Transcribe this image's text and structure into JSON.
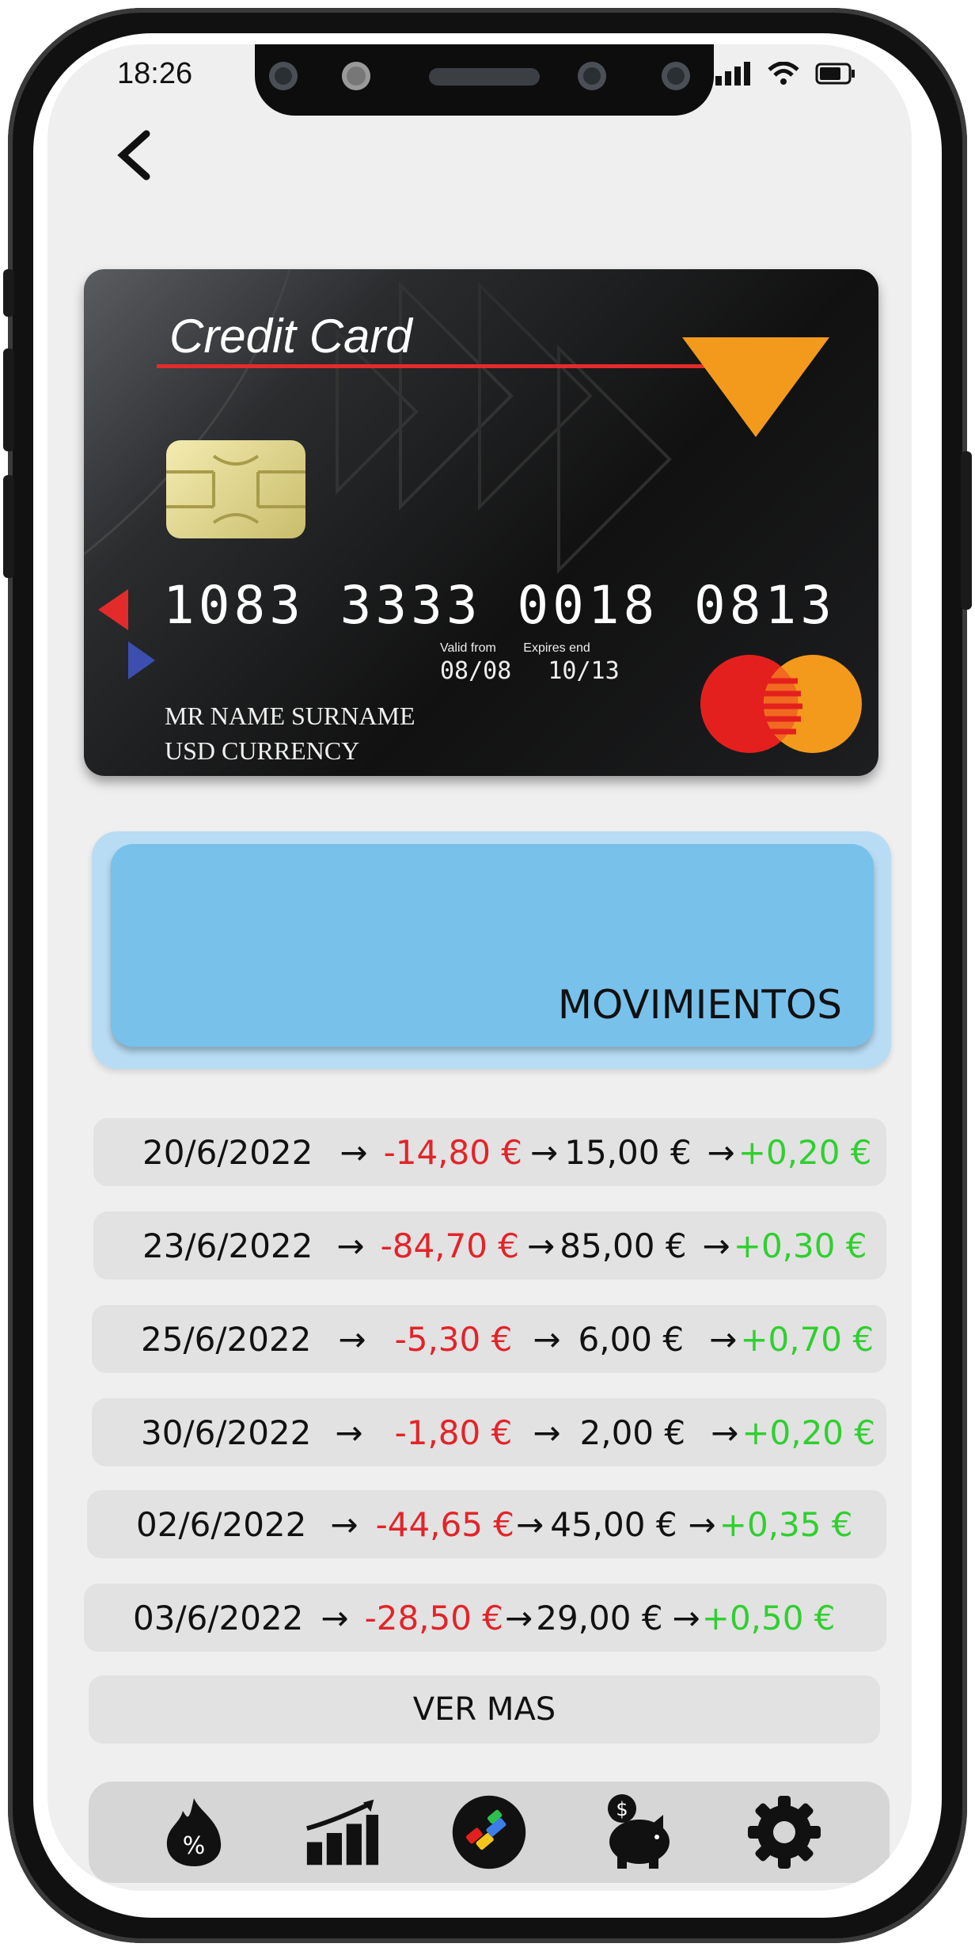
{
  "status_bar": {
    "time": "18:26"
  },
  "card": {
    "title": "Credit Card",
    "number": "1083 3333 0018 0813",
    "valid_from_label": "Valid from",
    "expires_label": "Expires end",
    "valid_from": "08/08",
    "expires": "10/13",
    "holder_name": "MR NAME SURNAME",
    "currency": "USD CURRENCY",
    "brand_icon": "mastercard-logo"
  },
  "movimientos": {
    "label": "MOVIMIENTOS",
    "color": "#78c1ea"
  },
  "transactions": [
    {
      "date": "20/6/2022",
      "debit": "-14,80 €",
      "rounded": "15,00 €",
      "saved": "+0,20 €"
    },
    {
      "date": "23/6/2022",
      "debit": "-84,70 €",
      "rounded": "85,00 €",
      "saved": "+0,30 €"
    },
    {
      "date": "25/6/2022",
      "debit": "-5,30 €",
      "rounded": "6,00 €",
      "saved": "+0,70 €"
    },
    {
      "date": "30/6/2022",
      "debit": "-1,80 €",
      "rounded": "2,00 €",
      "saved": "+0,20 €"
    },
    {
      "date": "02/6/2022",
      "debit": "-44,65 €",
      "rounded": "45,00 €",
      "saved": "+0,35 €"
    },
    {
      "date": "03/6/2022",
      "debit": "-28,50 €",
      "rounded": "29,00 €",
      "saved": "+0,50 €"
    }
  ],
  "arrow": "→",
  "ver_mas": "VER MAS",
  "bottom_nav": [
    {
      "icon": "discount-flame-icon"
    },
    {
      "icon": "growth-chart-icon"
    },
    {
      "icon": "app-logo-icon"
    },
    {
      "icon": "piggy-bank-icon"
    },
    {
      "icon": "gear-icon"
    }
  ],
  "colors": {
    "negative": "#e2242a",
    "positive": "#30cf30",
    "card_accent": "#f39a1c"
  }
}
